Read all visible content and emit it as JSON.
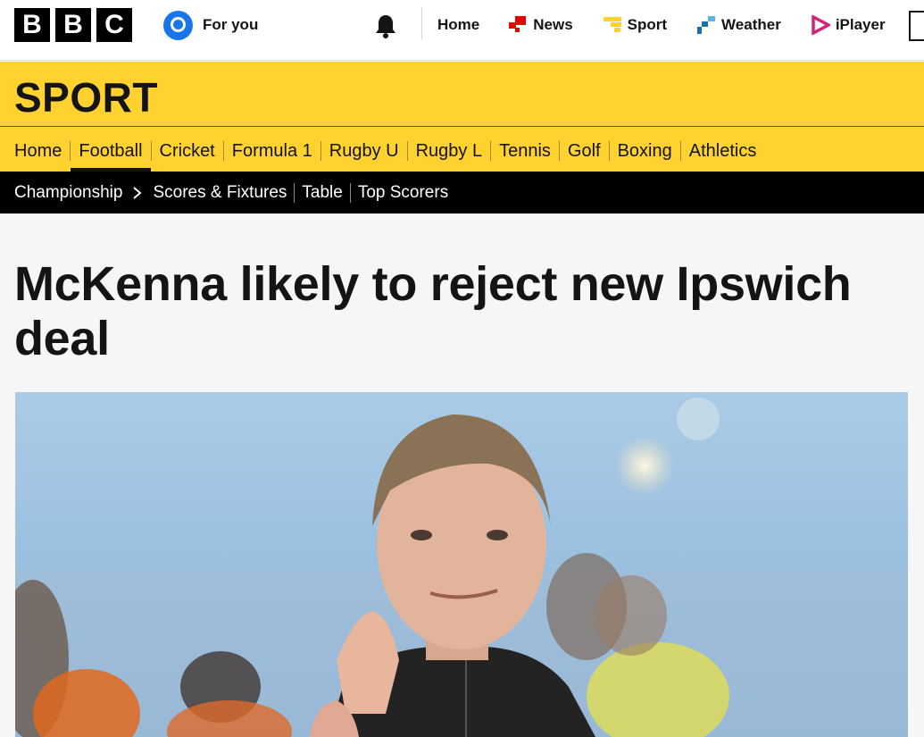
{
  "brand": {
    "letters": [
      "B",
      "B",
      "C"
    ]
  },
  "masthead": {
    "for_you_label": "For you",
    "nav": [
      {
        "label": "Home",
        "icon": "none"
      },
      {
        "label": "News",
        "icon": "news-icon"
      },
      {
        "label": "Sport",
        "icon": "sport-icon"
      },
      {
        "label": "Weather",
        "icon": "weather-icon"
      },
      {
        "label": "iPlayer",
        "icon": "iplayer-icon"
      }
    ]
  },
  "section": {
    "title": "SPORT",
    "nav": [
      "Home",
      "Football",
      "Cricket",
      "Formula 1",
      "Rugby U",
      "Rugby L",
      "Tennis",
      "Golf",
      "Boxing",
      "Athletics"
    ],
    "active": "Football"
  },
  "subnav": {
    "breadcrumb": "Championship",
    "links": [
      "Scores & Fixtures",
      "Table",
      "Top Scorers"
    ]
  },
  "article": {
    "headline": "McKenna likely to reject new Ipswich deal"
  },
  "colors": {
    "sport_yellow": "#ffd230",
    "news_red": "#e60000",
    "weather_blue": "#1d6fa5",
    "iplayer_pink": "#d6217a",
    "account_blue": "#1976ea"
  }
}
